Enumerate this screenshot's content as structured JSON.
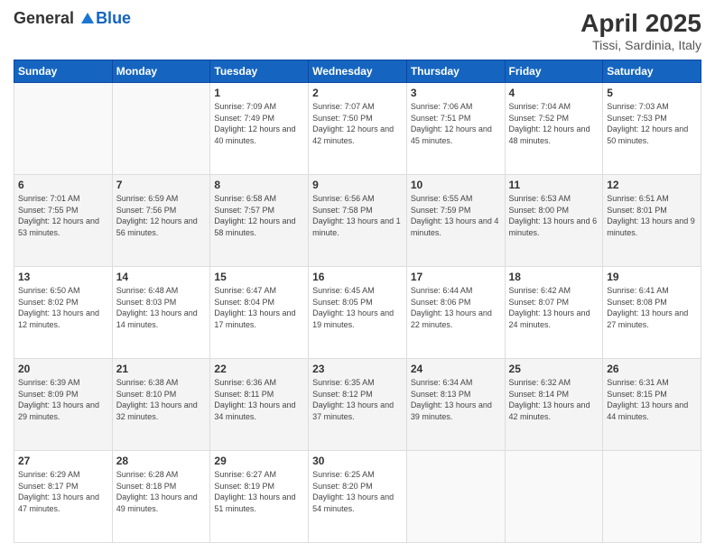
{
  "header": {
    "logo_line1": "General",
    "logo_line2": "Blue",
    "title": "April 2025",
    "subtitle": "Tissi, Sardinia, Italy"
  },
  "weekdays": [
    "Sunday",
    "Monday",
    "Tuesday",
    "Wednesday",
    "Thursday",
    "Friday",
    "Saturday"
  ],
  "weeks": [
    [
      {
        "day": "",
        "info": ""
      },
      {
        "day": "",
        "info": ""
      },
      {
        "day": "1",
        "info": "Sunrise: 7:09 AM\nSunset: 7:49 PM\nDaylight: 12 hours and 40 minutes."
      },
      {
        "day": "2",
        "info": "Sunrise: 7:07 AM\nSunset: 7:50 PM\nDaylight: 12 hours and 42 minutes."
      },
      {
        "day": "3",
        "info": "Sunrise: 7:06 AM\nSunset: 7:51 PM\nDaylight: 12 hours and 45 minutes."
      },
      {
        "day": "4",
        "info": "Sunrise: 7:04 AM\nSunset: 7:52 PM\nDaylight: 12 hours and 48 minutes."
      },
      {
        "day": "5",
        "info": "Sunrise: 7:03 AM\nSunset: 7:53 PM\nDaylight: 12 hours and 50 minutes."
      }
    ],
    [
      {
        "day": "6",
        "info": "Sunrise: 7:01 AM\nSunset: 7:55 PM\nDaylight: 12 hours and 53 minutes."
      },
      {
        "day": "7",
        "info": "Sunrise: 6:59 AM\nSunset: 7:56 PM\nDaylight: 12 hours and 56 minutes."
      },
      {
        "day": "8",
        "info": "Sunrise: 6:58 AM\nSunset: 7:57 PM\nDaylight: 12 hours and 58 minutes."
      },
      {
        "day": "9",
        "info": "Sunrise: 6:56 AM\nSunset: 7:58 PM\nDaylight: 13 hours and 1 minute."
      },
      {
        "day": "10",
        "info": "Sunrise: 6:55 AM\nSunset: 7:59 PM\nDaylight: 13 hours and 4 minutes."
      },
      {
        "day": "11",
        "info": "Sunrise: 6:53 AM\nSunset: 8:00 PM\nDaylight: 13 hours and 6 minutes."
      },
      {
        "day": "12",
        "info": "Sunrise: 6:51 AM\nSunset: 8:01 PM\nDaylight: 13 hours and 9 minutes."
      }
    ],
    [
      {
        "day": "13",
        "info": "Sunrise: 6:50 AM\nSunset: 8:02 PM\nDaylight: 13 hours and 12 minutes."
      },
      {
        "day": "14",
        "info": "Sunrise: 6:48 AM\nSunset: 8:03 PM\nDaylight: 13 hours and 14 minutes."
      },
      {
        "day": "15",
        "info": "Sunrise: 6:47 AM\nSunset: 8:04 PM\nDaylight: 13 hours and 17 minutes."
      },
      {
        "day": "16",
        "info": "Sunrise: 6:45 AM\nSunset: 8:05 PM\nDaylight: 13 hours and 19 minutes."
      },
      {
        "day": "17",
        "info": "Sunrise: 6:44 AM\nSunset: 8:06 PM\nDaylight: 13 hours and 22 minutes."
      },
      {
        "day": "18",
        "info": "Sunrise: 6:42 AM\nSunset: 8:07 PM\nDaylight: 13 hours and 24 minutes."
      },
      {
        "day": "19",
        "info": "Sunrise: 6:41 AM\nSunset: 8:08 PM\nDaylight: 13 hours and 27 minutes."
      }
    ],
    [
      {
        "day": "20",
        "info": "Sunrise: 6:39 AM\nSunset: 8:09 PM\nDaylight: 13 hours and 29 minutes."
      },
      {
        "day": "21",
        "info": "Sunrise: 6:38 AM\nSunset: 8:10 PM\nDaylight: 13 hours and 32 minutes."
      },
      {
        "day": "22",
        "info": "Sunrise: 6:36 AM\nSunset: 8:11 PM\nDaylight: 13 hours and 34 minutes."
      },
      {
        "day": "23",
        "info": "Sunrise: 6:35 AM\nSunset: 8:12 PM\nDaylight: 13 hours and 37 minutes."
      },
      {
        "day": "24",
        "info": "Sunrise: 6:34 AM\nSunset: 8:13 PM\nDaylight: 13 hours and 39 minutes."
      },
      {
        "day": "25",
        "info": "Sunrise: 6:32 AM\nSunset: 8:14 PM\nDaylight: 13 hours and 42 minutes."
      },
      {
        "day": "26",
        "info": "Sunrise: 6:31 AM\nSunset: 8:15 PM\nDaylight: 13 hours and 44 minutes."
      }
    ],
    [
      {
        "day": "27",
        "info": "Sunrise: 6:29 AM\nSunset: 8:17 PM\nDaylight: 13 hours and 47 minutes."
      },
      {
        "day": "28",
        "info": "Sunrise: 6:28 AM\nSunset: 8:18 PM\nDaylight: 13 hours and 49 minutes."
      },
      {
        "day": "29",
        "info": "Sunrise: 6:27 AM\nSunset: 8:19 PM\nDaylight: 13 hours and 51 minutes."
      },
      {
        "day": "30",
        "info": "Sunrise: 6:25 AM\nSunset: 8:20 PM\nDaylight: 13 hours and 54 minutes."
      },
      {
        "day": "",
        "info": ""
      },
      {
        "day": "",
        "info": ""
      },
      {
        "day": "",
        "info": ""
      }
    ]
  ]
}
